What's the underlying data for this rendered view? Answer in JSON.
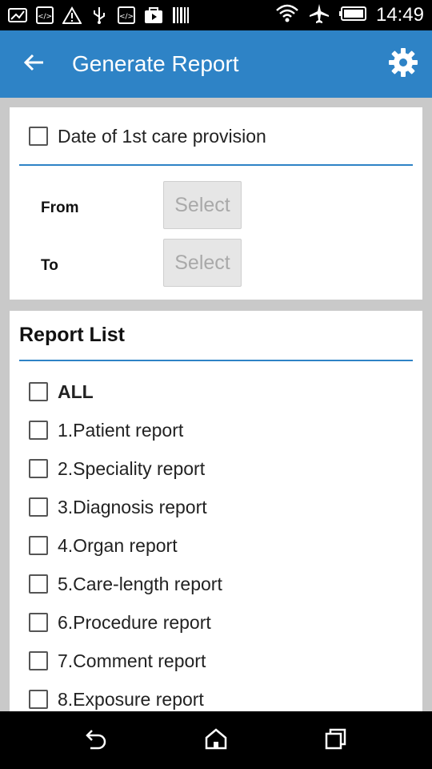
{
  "status_bar": {
    "time": "14:49",
    "left_icons": [
      "image-icon",
      "code-icon",
      "warning-icon",
      "usb-icon",
      "code-icon",
      "play-store-icon",
      "barcode-icon"
    ],
    "right_icons": [
      "wifi-icon",
      "airplane-icon",
      "battery-icon"
    ]
  },
  "app_bar": {
    "title": "Generate Report",
    "back_icon": "back-arrow-icon",
    "settings_icon": "gear-icon",
    "color": "#2e83c6"
  },
  "date_card": {
    "checkbox_label": "Date of 1st care provision",
    "from_label": "From",
    "to_label": "To",
    "from_button": "Select",
    "to_button": "Select"
  },
  "report_list": {
    "title": "Report List",
    "items": [
      {
        "label": "ALL",
        "bold": true
      },
      {
        "label": "1.Patient report"
      },
      {
        "label": "2.Speciality report"
      },
      {
        "label": "3.Diagnosis report"
      },
      {
        "label": "4.Organ report"
      },
      {
        "label": "5.Care-length report"
      },
      {
        "label": "6.Procedure report"
      },
      {
        "label": "7.Comment report"
      },
      {
        "label": "8.Exposure report"
      }
    ]
  },
  "nav_bar": {
    "icons": [
      "back-nav-icon",
      "home-icon",
      "recents-icon"
    ]
  }
}
